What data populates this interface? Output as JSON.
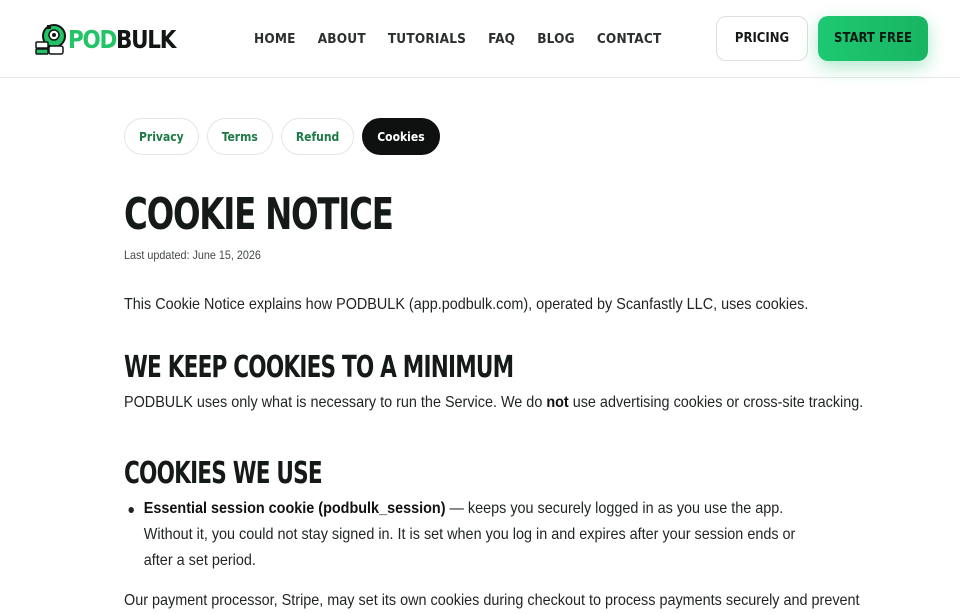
{
  "brand": {
    "part1": "POD",
    "part2": "BULK",
    "accent": "#22c467"
  },
  "nav": {
    "items": [
      "HOME",
      "ABOUT",
      "TUTORIALS",
      "FAQ",
      "BLOG",
      "CONTACT"
    ]
  },
  "header_buttons": {
    "pricing": "PRICING",
    "start": "START FREE"
  },
  "tabs": [
    {
      "label": "Privacy",
      "active": false
    },
    {
      "label": "Terms",
      "active": false
    },
    {
      "label": "Refund",
      "active": false
    },
    {
      "label": "Cookies",
      "active": true
    }
  ],
  "page": {
    "title": "COOKIE NOTICE",
    "updated": "Last updated: June 15, 2026",
    "intro": "This Cookie Notice explains how PODBULK (app.podbulk.com), operated by Scanfastly LLC, uses cookies.",
    "section1": {
      "heading": "WE KEEP COOKIES TO A MINIMUM",
      "text_before": "PODBULK uses only what is necessary to run the Service. We do ",
      "text_bold": "not",
      "text_after": " use advertising cookies or cross-site tracking."
    },
    "section2": {
      "heading": "COOKIES WE USE",
      "bullet_bold": "Essential session cookie (podbulk_session)",
      "bullet_text": " — keeps you securely logged in as you use the app. Without it, you could not stay signed in. It is set when you log in and expires after your session ends or after a set period.",
      "after": "Our payment processor, Stripe, may set its own cookies during checkout to process payments securely and prevent"
    }
  }
}
